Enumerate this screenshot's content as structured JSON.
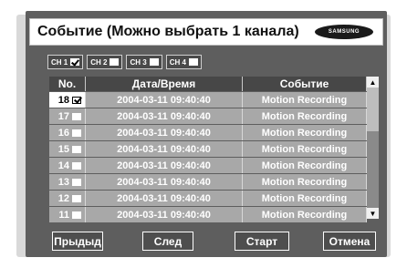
{
  "title": "Событие (Можно выбрать 1 канала)",
  "logo": "SAMSUNG",
  "channels": [
    {
      "label": "CH 1",
      "checked": true
    },
    {
      "label": "CH 2",
      "checked": false
    },
    {
      "label": "CH 3",
      "checked": false
    },
    {
      "label": "CH 4",
      "checked": false
    }
  ],
  "table": {
    "headers": {
      "no": "No.",
      "datetime": "Дата/Время",
      "event": "Событие"
    },
    "rows": [
      {
        "no": "18",
        "datetime": "2004-03-11  09:40:40",
        "event": "Motion Recording",
        "checked": true
      },
      {
        "no": "17",
        "datetime": "2004-03-11  09:40:40",
        "event": "Motion Recording",
        "checked": false
      },
      {
        "no": "16",
        "datetime": "2004-03-11  09:40:40",
        "event": "Motion Recording",
        "checked": false
      },
      {
        "no": "15",
        "datetime": "2004-03-11  09:40:40",
        "event": "Motion Recording",
        "checked": false
      },
      {
        "no": "14",
        "datetime": "2004-03-11  09:40:40",
        "event": "Motion Recording",
        "checked": false
      },
      {
        "no": "13",
        "datetime": "2004-03-11  09:40:40",
        "event": "Motion Recording",
        "checked": false
      },
      {
        "no": "12",
        "datetime": "2004-03-11  09:40:40",
        "event": "Motion Recording",
        "checked": false
      },
      {
        "no": "11",
        "datetime": "2004-03-11  09:40:40",
        "event": "Motion Recording",
        "checked": false
      }
    ]
  },
  "buttons": {
    "prev": "Прыдыд",
    "next": "След",
    "start": "Старт",
    "cancel": "Отмена"
  },
  "scroll": {
    "up_icon": "up-arrow-icon",
    "down_icon": "down-arrow-icon"
  }
}
